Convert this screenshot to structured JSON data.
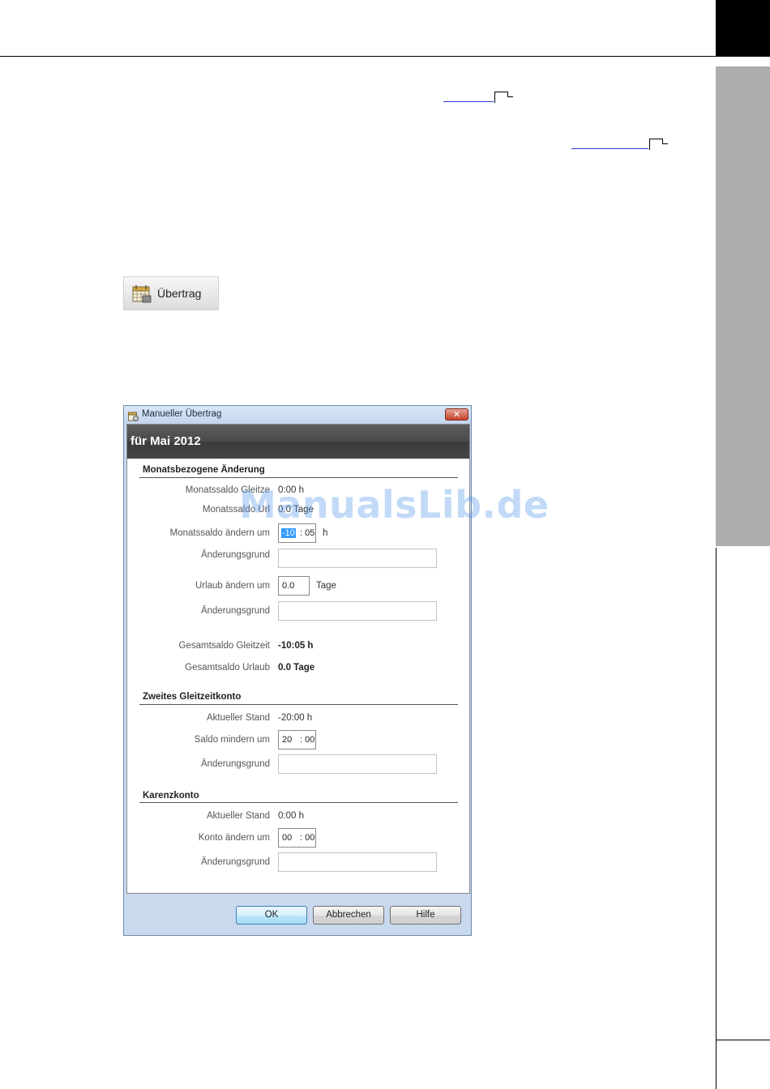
{
  "toolbar_button": {
    "label": "Übertrag",
    "icon": "calendar-icon"
  },
  "dialog": {
    "title": "Manueller Übertrag",
    "close_label": "✕",
    "header": "für Mai 2012",
    "sections": {
      "monthly": {
        "title": "Monatsbezogene Änderung",
        "rows": {
          "saldo_gleitzeit": {
            "label": "Monatssaldo Gleitze",
            "value": "0:00 h"
          },
          "saldo_urlaub": {
            "label": "Monatssaldo Url",
            "value": "0.0 Tage"
          },
          "saldo_aendern": {
            "label": "Monatssaldo ändern um",
            "hours": "-10",
            "minutes": ": 05",
            "unit": "h"
          },
          "reason1": {
            "label": "Änderungsgrund",
            "value": ""
          },
          "urlaub_aendern": {
            "label": "Urlaub ändern um",
            "value": "0.0",
            "unit": "Tage"
          },
          "reason2": {
            "label": "Änderungsgrund",
            "value": ""
          },
          "gesamt_gleitzeit": {
            "label": "Gesamtsaldo Gleitzeit",
            "value": "-10:05 h"
          },
          "gesamt_urlaub": {
            "label": "Gesamtsaldo Urlaub",
            "value": "0.0 Tage"
          }
        }
      },
      "second_account": {
        "title": "Zweites Gleitzeitkonto",
        "rows": {
          "stand": {
            "label": "Aktueller Stand",
            "value": "-20:00 h"
          },
          "mindern": {
            "label": "Saldo mindern um",
            "hours": "20",
            "minutes": ": 00"
          },
          "reason": {
            "label": "Änderungsgrund",
            "value": ""
          }
        }
      },
      "karenz": {
        "title": "Karenzkonto",
        "rows": {
          "stand": {
            "label": "Aktueller Stand",
            "value": "0:00 h"
          },
          "aendern": {
            "label": "Konto ändern um",
            "hours": "00",
            "minutes": ": 00"
          },
          "reason": {
            "label": "Änderungsgrund",
            "value": ""
          }
        }
      }
    },
    "buttons": {
      "ok": "OK",
      "cancel": "Abbrechen",
      "help": "Hilfe"
    }
  },
  "watermark": "ManualsLib.de",
  "colors": {
    "sidebar_gray": "#adadad",
    "dialog_header": "#444444",
    "selection": "#3399ff",
    "link": "#2a3bd6"
  }
}
